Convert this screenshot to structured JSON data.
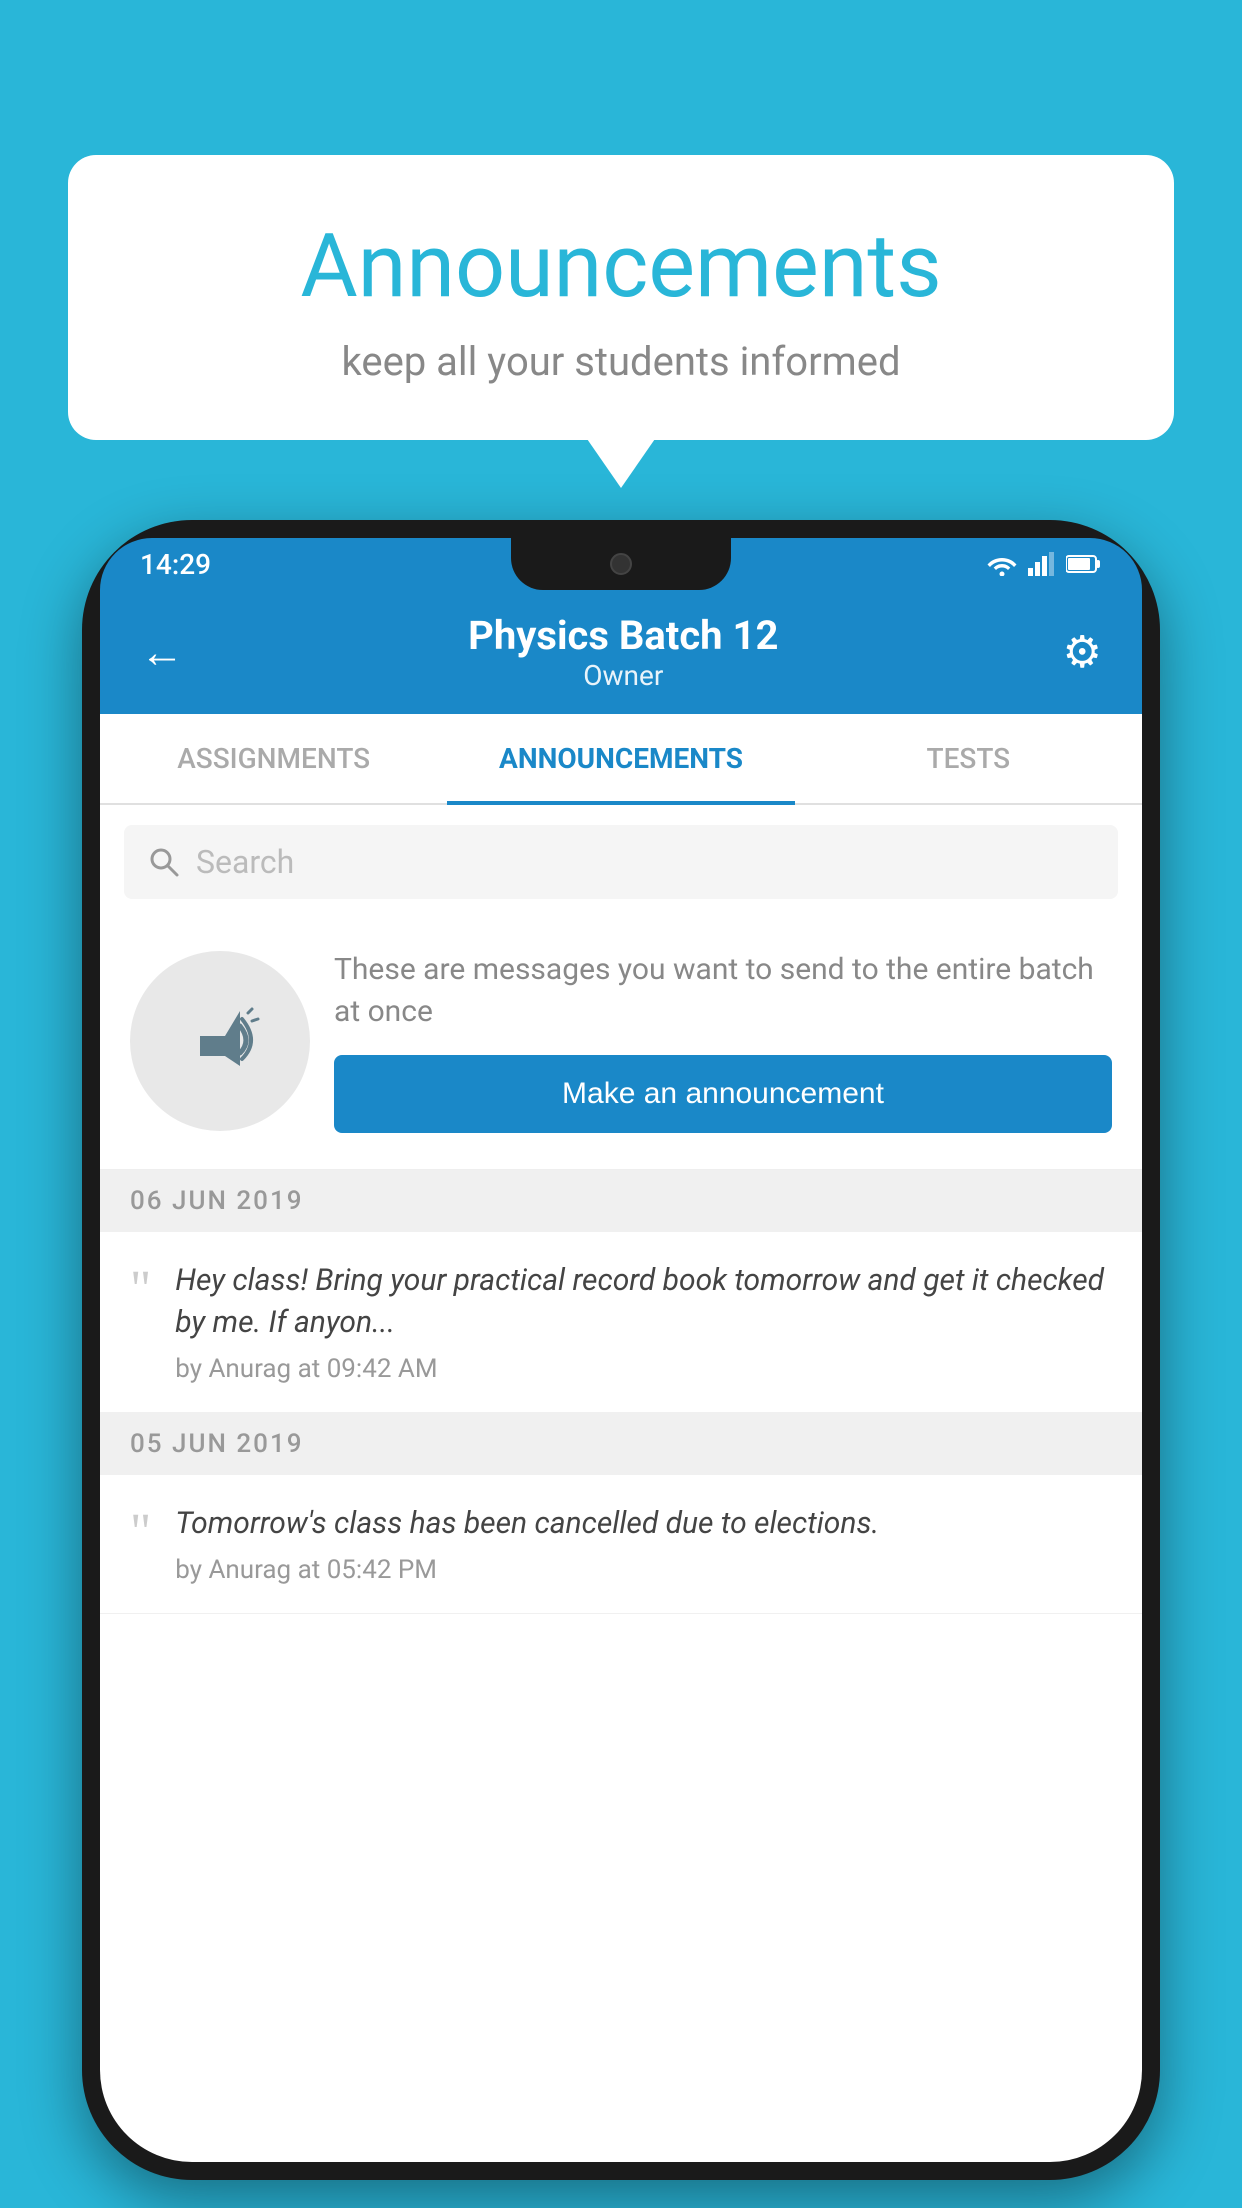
{
  "background_color": "#29b6d8",
  "speech_bubble": {
    "title": "Announcements",
    "subtitle": "keep all your students informed"
  },
  "phone": {
    "status_bar": {
      "time": "14:29",
      "icons": [
        "wifi",
        "signal",
        "battery"
      ]
    },
    "header": {
      "back_label": "←",
      "title": "Physics Batch 12",
      "subtitle": "Owner",
      "gear_label": "⚙"
    },
    "tabs": [
      {
        "label": "ASSIGNMENTS",
        "active": false
      },
      {
        "label": "ANNOUNCEMENTS",
        "active": true
      },
      {
        "label": "TESTS",
        "active": false
      },
      {
        "label": "...",
        "active": false
      }
    ],
    "search": {
      "placeholder": "Search"
    },
    "promo": {
      "description": "These are messages you want to send to the entire batch at once",
      "button_label": "Make an announcement"
    },
    "announcements": [
      {
        "date": "06  JUN  2019",
        "items": [
          {
            "text": "Hey class! Bring your practical record book tomorrow and get it checked by me. If anyon...",
            "meta": "by Anurag at 09:42 AM"
          }
        ]
      },
      {
        "date": "05  JUN  2019",
        "items": [
          {
            "text": "Tomorrow's class has been cancelled due to elections.",
            "meta": "by Anurag at 05:42 PM"
          }
        ]
      }
    ]
  }
}
